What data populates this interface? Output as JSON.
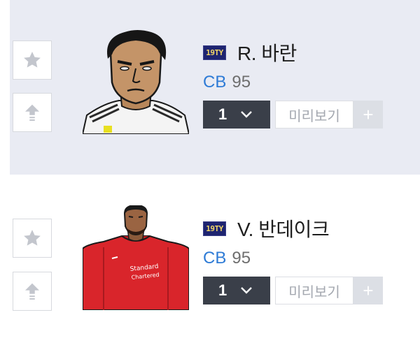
{
  "players": [
    {
      "season_badge": "19TY",
      "name": "R. 바란",
      "position": "CB",
      "ovr": "95",
      "level": "1",
      "preview_label": "미리보기",
      "plus_label": "+"
    },
    {
      "season_badge": "19TY",
      "name": "V. 반데이크",
      "position": "CB",
      "ovr": "95",
      "level": "1",
      "preview_label": "미리보기",
      "plus_label": "+"
    }
  ],
  "colors": {
    "row_highlight": "#e9ebf3",
    "position_blue": "#2e7bd6",
    "level_dark": "#3a3f49",
    "season_navy": "#1e2470",
    "season_gold": "#f2d667"
  },
  "icons": [
    "star-icon",
    "upgrade-arrow-icon",
    "chevron-down-icon"
  ]
}
